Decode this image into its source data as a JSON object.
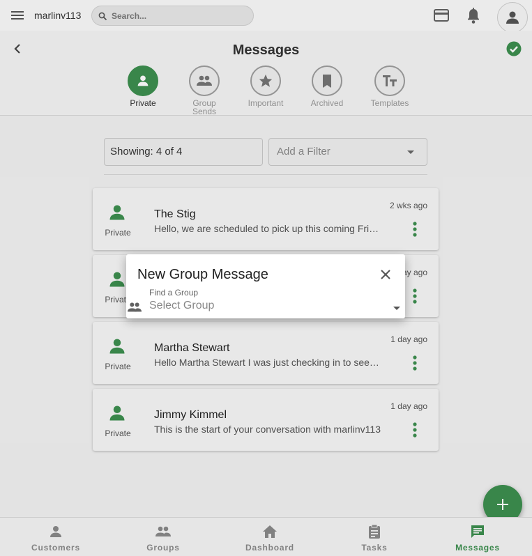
{
  "topbar": {
    "username": "marlinv113",
    "search_placeholder": "Search..."
  },
  "header": {
    "title": "Messages",
    "tabs": [
      {
        "label": "Private",
        "icon": "person-icon",
        "active": true
      },
      {
        "label": "Group\nSends",
        "icon": "group-icon",
        "active": false
      },
      {
        "label": "Important",
        "icon": "star-icon",
        "active": false
      },
      {
        "label": "Archived",
        "icon": "bookmark-icon",
        "active": false
      },
      {
        "label": "Templates",
        "icon": "text-format-icon",
        "active": false
      }
    ]
  },
  "filters": {
    "showing": "Showing: 4 of 4",
    "add_filter_placeholder": "Add a Filter"
  },
  "conversations": [
    {
      "type": "Private",
      "name": "The Stig",
      "preview": "Hello, we are scheduled to pick up this coming Friday",
      "time": "2 wks ago"
    },
    {
      "type": "Private",
      "name": "",
      "preview": "",
      "time": "ay ago"
    },
    {
      "type": "Private",
      "name": "Martha Stewart",
      "preview": "Hello Martha Stewart I was just checking in to see how you are",
      "time": "1 day ago"
    },
    {
      "type": "Private",
      "name": "Jimmy Kimmel",
      "preview": "This is the start of your conversation with marlinv113",
      "time": "1 day ago"
    }
  ],
  "dialog": {
    "title": "New Group Message",
    "field_label": "Find a Group",
    "select_placeholder": "Select Group"
  },
  "bottom_nav": [
    {
      "label": "Customers",
      "icon": "person-icon",
      "active": false
    },
    {
      "label": "Groups",
      "icon": "group-icon",
      "active": false
    },
    {
      "label": "Dashboard",
      "icon": "home-icon",
      "active": false
    },
    {
      "label": "Tasks",
      "icon": "clipboard-icon",
      "active": false
    },
    {
      "label": "Messages",
      "icon": "chat-icon",
      "active": true
    }
  ],
  "colors": {
    "accent": "#3d8f4f",
    "icon_gray": "#616161"
  }
}
